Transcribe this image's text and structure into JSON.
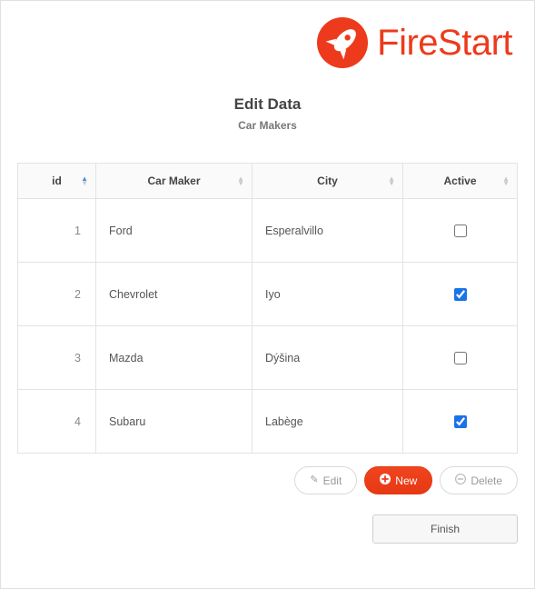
{
  "brand": {
    "name": "FireStart"
  },
  "heading": {
    "title": "Edit Data",
    "subtitle": "Car Makers"
  },
  "table": {
    "headers": {
      "id": "id",
      "maker": "Car Maker",
      "city": "City",
      "active": "Active"
    },
    "rows": [
      {
        "id": "1",
        "maker": "Ford",
        "city": "Esperalvillo",
        "active": false
      },
      {
        "id": "2",
        "maker": "Chevrolet",
        "city": "Iyo",
        "active": true
      },
      {
        "id": "3",
        "maker": "Mazda",
        "city": "Dýšina",
        "active": false
      },
      {
        "id": "4",
        "maker": "Subaru",
        "city": "Labège",
        "active": true
      }
    ]
  },
  "buttons": {
    "edit": "Edit",
    "new": "New",
    "delete": "Delete",
    "finish": "Finish"
  }
}
